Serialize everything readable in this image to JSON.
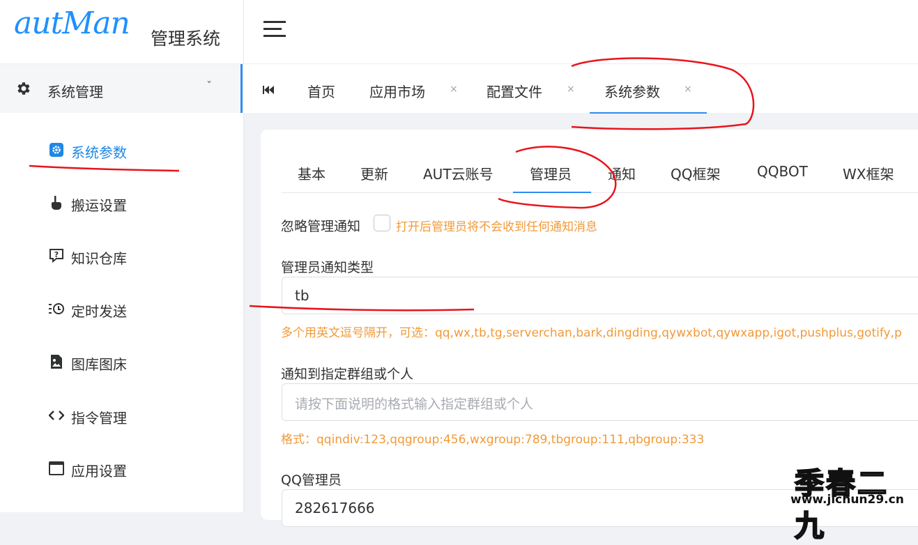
{
  "brand": {
    "logo_text": "autMan",
    "title": "管理系统"
  },
  "sidebar": {
    "group": {
      "label": "系统管理",
      "icon": "gear-icon"
    },
    "items": [
      {
        "label": "系统参数",
        "icon": "gear-square-icon",
        "active": true
      },
      {
        "label": "搬运设置",
        "icon": "hand-pointer-icon"
      },
      {
        "label": "知识仓库",
        "icon": "question-bubble-icon"
      },
      {
        "label": "定时发送",
        "icon": "clock-list-icon"
      },
      {
        "label": "图库图床",
        "icon": "image-file-icon"
      },
      {
        "label": "指令管理",
        "icon": "code-icon"
      },
      {
        "label": "应用设置",
        "icon": "window-icon"
      }
    ]
  },
  "tabs": {
    "first_icon": "skip-back-icon",
    "items": [
      {
        "label": "首页"
      },
      {
        "label": "应用市场",
        "close": "×"
      },
      {
        "label": "配置文件",
        "close": "×"
      },
      {
        "label": "系统参数",
        "close": "×",
        "active": true
      }
    ]
  },
  "subtabs": [
    "基本",
    "更新",
    "AUT云账号",
    "管理员",
    "通知",
    "QQ框架",
    "QQBOT",
    "WX框架"
  ],
  "subtab_active": "管理员",
  "form": {
    "ignore_label": "忽略管理通知",
    "ignore_checked": false,
    "ignore_hint": "打开后管理员将不会收到任何通知消息",
    "type_label": "管理员通知类型",
    "type_value": "tb",
    "type_hint": "多个用英文逗号隔开，可选：qq,wx,tb,tg,serverchan,bark,dingding,qywxbot,qywxapp,igot,pushplus,gotify,p",
    "target_label": "通知到指定群组或个人",
    "target_placeholder": "请按下面说明的格式输入指定群组或个人",
    "target_hint": "格式：qqindiv:123,qqgroup:456,wxgroup:789,tbgroup:111,qbgroup:333",
    "qq_admin_label": "QQ管理员",
    "qq_admin_value": "282617666"
  },
  "watermark": {
    "text": "季春二九",
    "url": "www.jichun29.cn"
  },
  "colors": {
    "accent": "#2d8cf0",
    "hint": "#f19a38",
    "annotation": "#e8141c"
  }
}
